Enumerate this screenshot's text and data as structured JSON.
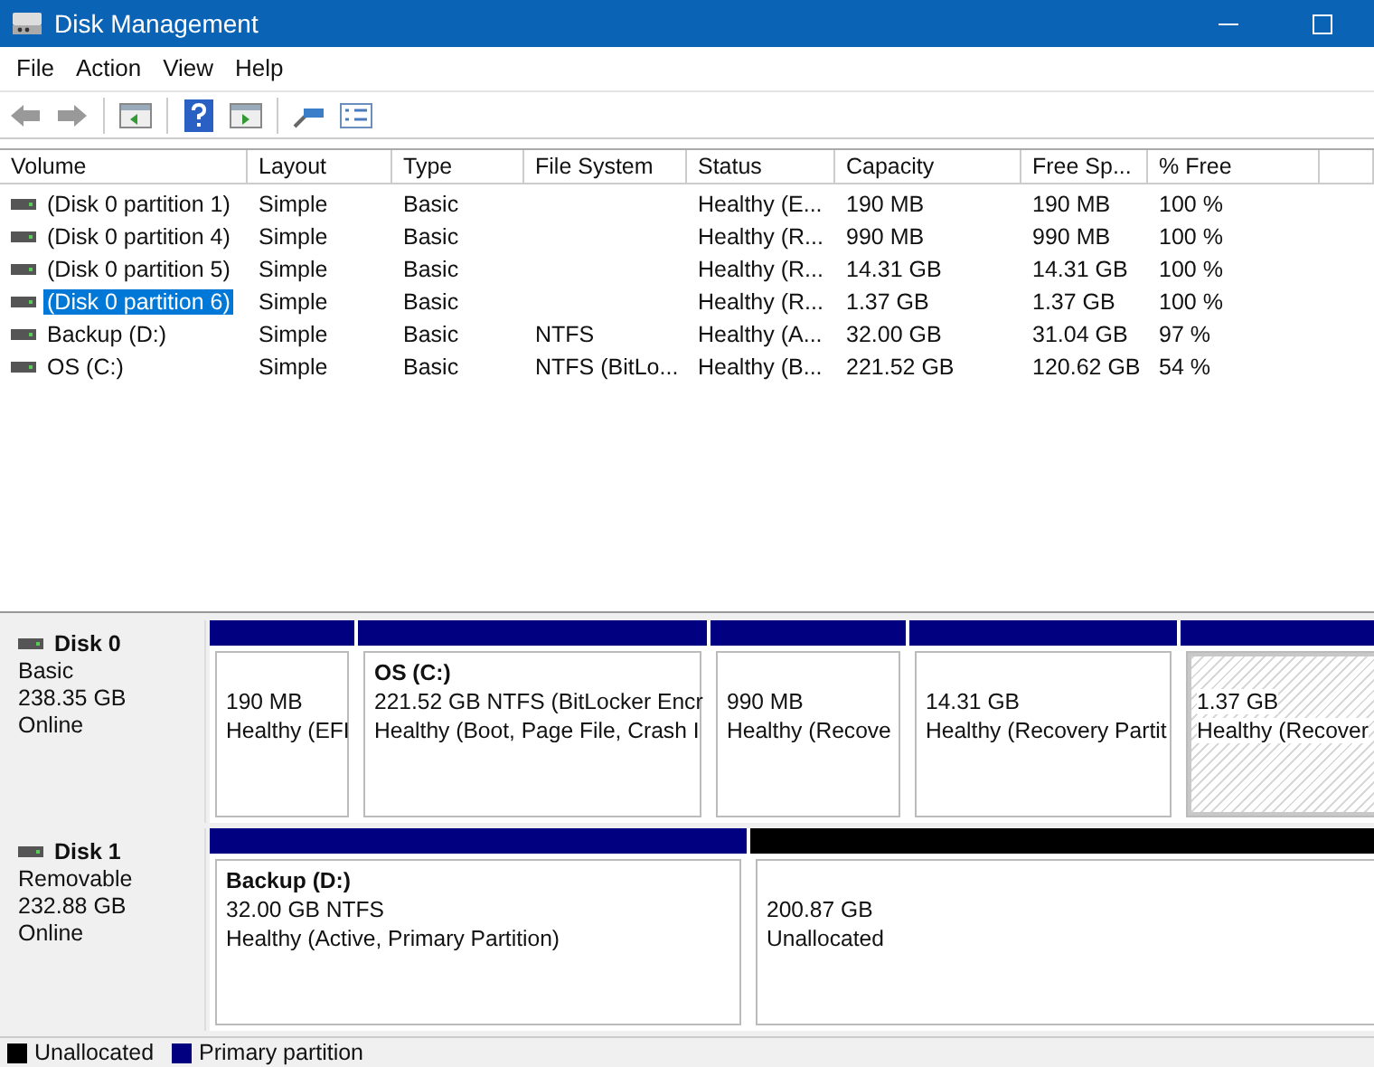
{
  "window": {
    "title": "Disk Management"
  },
  "menu": [
    "File",
    "Action",
    "View",
    "Help"
  ],
  "table": {
    "columns": [
      "Volume",
      "Layout",
      "Type",
      "File System",
      "Status",
      "Capacity",
      "Free Sp...",
      "% Free"
    ],
    "rows": [
      {
        "cells": [
          "(Disk 0 partition 1)",
          "Simple",
          "Basic",
          null,
          "Healthy (E...",
          "190 MB",
          "190 MB",
          "100 %"
        ],
        "selected": false
      },
      {
        "cells": [
          "(Disk 0 partition 4)",
          "Simple",
          "Basic",
          null,
          "Healthy (R...",
          "990 MB",
          "990 MB",
          "100 %"
        ],
        "selected": false
      },
      {
        "cells": [
          "(Disk 0 partition 5)",
          "Simple",
          "Basic",
          null,
          "Healthy (R...",
          "14.31 GB",
          "14.31 GB",
          "100 %"
        ],
        "selected": false
      },
      {
        "cells": [
          "(Disk 0 partition 6)",
          "Simple",
          "Basic",
          null,
          "Healthy (R...",
          "1.37 GB",
          "1.37 GB",
          "100 %"
        ],
        "selected": true
      },
      {
        "cells": [
          "Backup (D:)",
          "Simple",
          "Basic",
          "NTFS",
          "Healthy (A...",
          "32.00 GB",
          "31.04 GB",
          "97 %"
        ],
        "selected": false
      },
      {
        "cells": [
          "OS (C:)",
          "Simple",
          "Basic",
          "NTFS (BitLo...",
          "Healthy (B...",
          "221.52 GB",
          "120.62 GB",
          "54 %"
        ],
        "selected": false
      }
    ]
  },
  "disks": [
    {
      "name": "Disk 0",
      "type": "Basic",
      "size": "238.35 GB",
      "status": "Online",
      "partitions": [
        {
          "kind": "primary",
          "lines": [
            "190 MB",
            "Healthy (EFI"
          ],
          "selected": false
        },
        {
          "kind": "primary",
          "title": "OS  (C:)",
          "lines": [
            "221.52 GB NTFS (BitLocker Encr",
            "Healthy (Boot, Page File, Crash I"
          ],
          "selected": false
        },
        {
          "kind": "primary",
          "lines": [
            "990 MB",
            "Healthy (Recove"
          ],
          "selected": false
        },
        {
          "kind": "primary",
          "lines": [
            "14.31 GB",
            "Healthy (Recovery Partit"
          ],
          "selected": false
        },
        {
          "kind": "primary",
          "lines": [
            "1.37 GB",
            "Healthy (Recover"
          ],
          "selected": true
        }
      ]
    },
    {
      "name": "Disk 1",
      "type": "Removable",
      "size": "232.88 GB",
      "status": "Online",
      "partitions": [
        {
          "kind": "primary",
          "title": "Backup  (D:)",
          "lines": [
            "32.00 GB NTFS",
            "Healthy (Active, Primary Partition)"
          ],
          "selected": false
        },
        {
          "kind": "unallocated",
          "lines": [
            "200.87 GB",
            "Unallocated"
          ],
          "selected": false
        }
      ]
    }
  ],
  "legend": [
    {
      "label": "Unallocated",
      "color": "#000000"
    },
    {
      "label": "Primary partition",
      "color": "#000080"
    }
  ]
}
